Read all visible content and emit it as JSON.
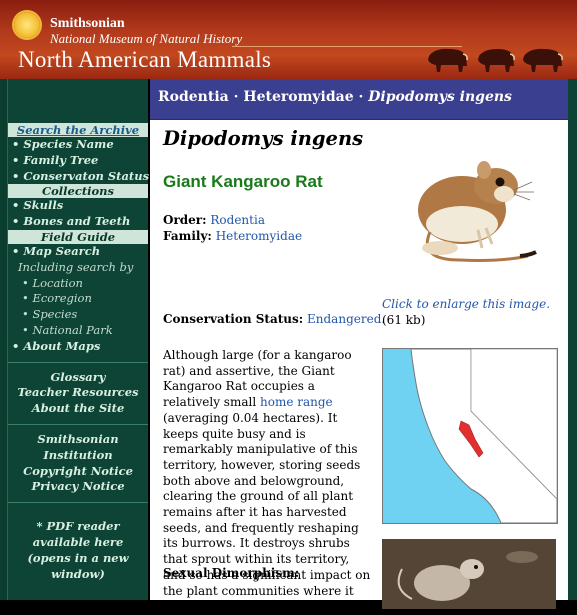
{
  "header": {
    "org": "Smithsonian",
    "museum": "National Museum of Natural History",
    "title": "North American Mammals"
  },
  "sidebar": {
    "search_archive": "Search the Archive",
    "search_items": [
      "• Species Name",
      "• Family Tree",
      "• Conservaton Status"
    ],
    "collections_head": "Collections",
    "collections_items": [
      "• Skulls",
      "• Bones and Teeth"
    ],
    "field_guide_head": "Field Guide",
    "field_items": [
      "• Map Search"
    ],
    "including": "Including search by",
    "including_items": [
      "• Location",
      "• Ecoregion",
      "• Species",
      "• National Park"
    ],
    "about_maps": "• About Maps",
    "group1": [
      "Glossary",
      "Teacher Resources",
      "About the Site"
    ],
    "group2": [
      "Smithsonian Institution",
      "Copyright Notice",
      "Privacy Notice"
    ],
    "pdf": [
      "* PDF reader",
      "available here",
      "(opens in a new window)"
    ]
  },
  "breadcrumb": {
    "order": "Rodentia",
    "sep1": " · ",
    "family": "Heteromyidae",
    "sep2": " · ",
    "species": "Dipodomys ingens"
  },
  "species": {
    "scientific_name": "Dipodomys ingens",
    "common_name": "Giant Kangaroo Rat",
    "order_label": "Order:",
    "order_value": "Rodentia",
    "family_label": "Family:",
    "family_value": "Heteromyidae",
    "enlarge_link": "Click to enlarge this image.",
    "enlarge_size": "(61 kb)",
    "conservation_label": "Conservation Status:",
    "conservation_value": "Endangered",
    "conservation_end": ".",
    "description_pre": "Although large (for a kangaroo rat) and assertive, the Giant Kangaroo Rat occupies a relatively small ",
    "description_link": "home range",
    "description_post": " (averaging 0.04 hectares). It keeps quite busy and is remarkably manipulative of this territory, however, storing seeds both above and belowground, clearing the ground of all plant remains after it has harvested seeds, and frequently reshaping its burrows. It destroys shrubs that sprout within its territory, and so has a significant impact on the plant communities where it lives out a solitary life.",
    "dimorphism_label": "Sexual Dimorphism:"
  },
  "colors": {
    "header_red": "#b23a1c",
    "sidebar_green": "#0d4435",
    "crumb_purple": "#3b3f8f",
    "common_name_green": "#1a7a1a",
    "link_blue": "#2255aa",
    "range_red": "#e03030",
    "map_water": "#6fd2f2"
  }
}
